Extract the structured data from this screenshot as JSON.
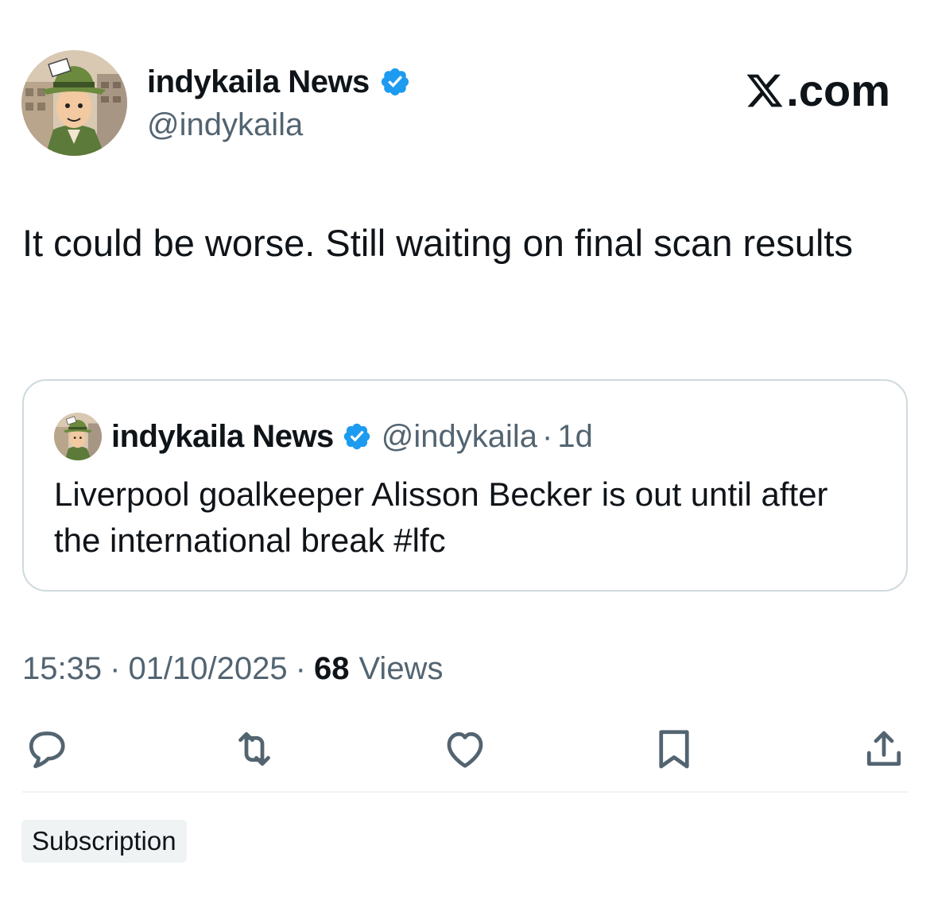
{
  "author": {
    "display_name": "indykaila News",
    "handle": "@indykaila",
    "avatar_icon": "cartoon-reporter-avatar",
    "verified_icon": "verified-badge-icon"
  },
  "brand": {
    "label": ".com",
    "icon": "x-logo-icon"
  },
  "tweet": {
    "text": "It could be worse. Still waiting on final scan results"
  },
  "quoted_tweet": {
    "display_name": "indykaila News",
    "handle": "@indykaila",
    "separator": "·",
    "age": "1d",
    "text": "Liverpool goalkeeper Alisson Becker is out until after the international break #lfc"
  },
  "meta": {
    "time": "15:35",
    "separator": "·",
    "date": "01/10/2025",
    "views_count": "68",
    "views_label": "Views"
  },
  "actions": [
    "reply-icon",
    "retweet-icon",
    "like-icon",
    "bookmark-icon",
    "share-icon"
  ],
  "footer": {
    "badge": "Subscription"
  },
  "colors": {
    "text_primary": "#0f1419",
    "text_secondary": "#536471",
    "verified_blue": "#1d9bf0",
    "border": "#cfd9de"
  }
}
